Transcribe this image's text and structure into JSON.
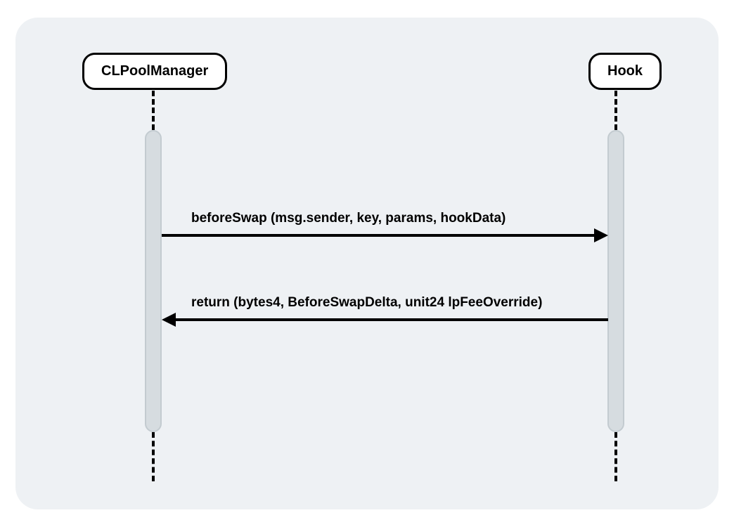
{
  "participants": {
    "left": "CLPoolManager",
    "right": "Hook"
  },
  "messages": {
    "forward": "beforeSwap (msg.sender, key, params, hookData)",
    "return": "return (bytes4, BeforeSwapDelta, unit24 lpFeeOverride)"
  }
}
